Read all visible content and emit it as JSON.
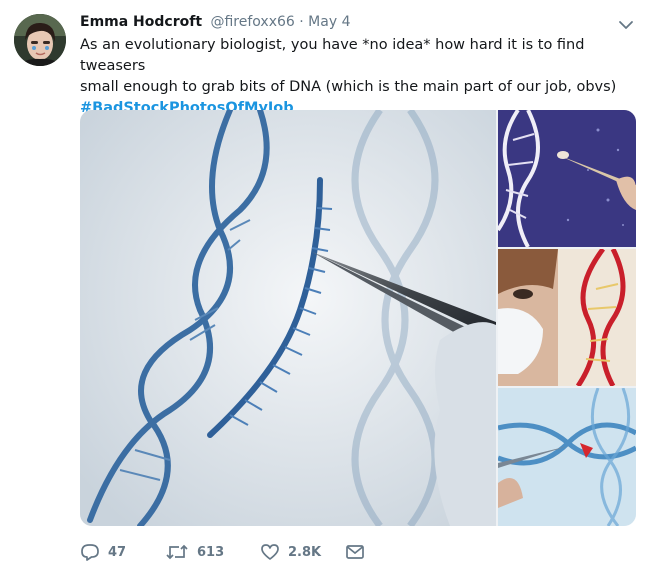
{
  "tweet": {
    "author_name": "Emma Hodcroft",
    "handle": "@firefoxx66",
    "separator": "·",
    "date": "May 4",
    "text_line1": "As an evolutionary biologist, you have *no idea* how hard it is to find tweasers",
    "text_line2": "small enough to grab bits of DNA (which is the main part of our job, obvs)",
    "hashtag": "#BadStockPhotosOfMyJob"
  },
  "actions": {
    "replies": "47",
    "retweets": "613",
    "likes": "2.8K"
  },
  "icons": {
    "reply": "reply-icon",
    "retweet": "retweet-icon",
    "like": "heart-icon",
    "dm": "mail-icon",
    "caret": "chevron-down-icon"
  },
  "colors": {
    "hashtag": "#1b95e0",
    "muted": "#657786",
    "text": "#14171a"
  }
}
